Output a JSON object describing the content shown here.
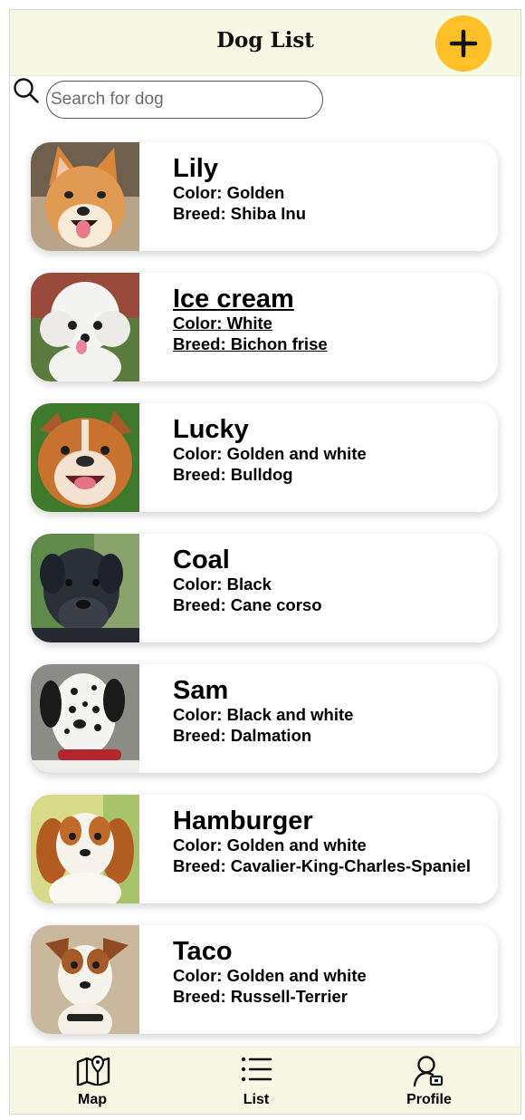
{
  "header": {
    "title": "Dog List"
  },
  "actions": {
    "add_icon": "plus-icon",
    "accent": "#ffc12a"
  },
  "search": {
    "placeholder": "Search for dog",
    "value": "",
    "icon": "search-icon"
  },
  "dogs": [
    {
      "name": "Lily",
      "color": "Color: Golden",
      "breed": "Breed: Shiba Inu"
    },
    {
      "name": "Ice cream",
      "color": "Color: White",
      "breed": "Breed: Bichon frise"
    },
    {
      "name": "Lucky",
      "color": "Color: Golden and white",
      "breed": "Breed: Bulldog"
    },
    {
      "name": "Coal",
      "color": "Color: Black",
      "breed": "Breed: Cane corso"
    },
    {
      "name": "Sam",
      "color": "Color: Black and white",
      "breed": "Breed: Dalmation"
    },
    {
      "name": "Hamburger",
      "color": "Color: Golden and white",
      "breed": "Breed: Cavalier-King-Charles-Spaniel"
    },
    {
      "name": "Taco",
      "color": "Color: Golden and white",
      "breed": "Breed: Russell-Terrier"
    }
  ],
  "tabs": [
    {
      "label": "Map",
      "icon": "map-icon"
    },
    {
      "label": "List",
      "icon": "list-icon"
    },
    {
      "label": "Profile",
      "icon": "profile-icon"
    }
  ],
  "theme": {
    "bar_background": "#f8f7e3"
  }
}
